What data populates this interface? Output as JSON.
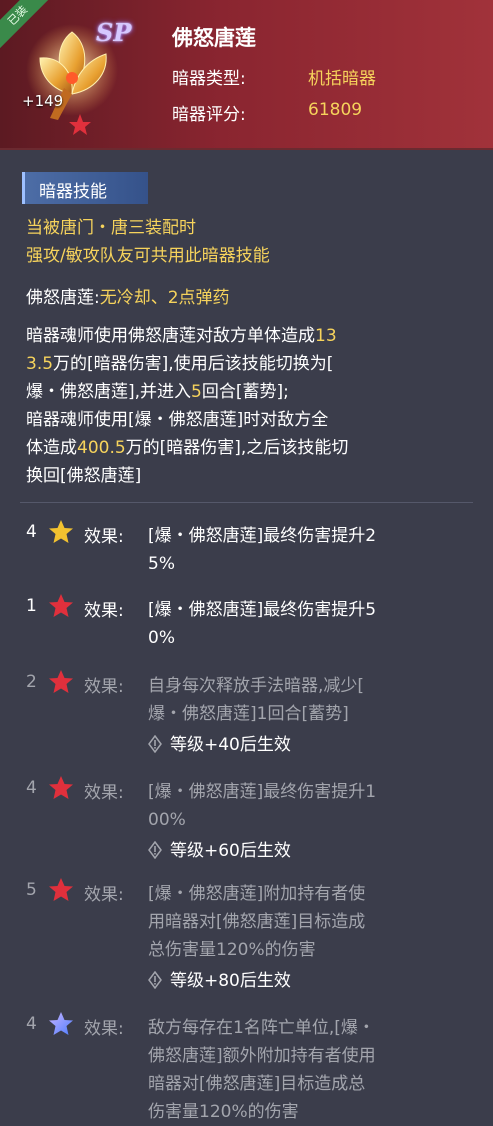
{
  "header": {
    "equipped_badge": "已装",
    "sp_badge": "SP",
    "level": "+149",
    "name": "佛怒唐莲",
    "type_label": "暗器类型:",
    "type_value": "机括暗器",
    "score_label": "暗器评分:",
    "score_value": "61809"
  },
  "skill": {
    "section_title": "暗器技能",
    "condition_lines": [
      "当被唐门・唐三装配时",
      "强攻/敏攻队友可共用此暗器技能"
    ],
    "name_label": "佛怒唐莲:",
    "name_detail": "无冷却、2点弹药",
    "desc_lines": [
      {
        "parts": [
          "暗器魂师使用佛怒唐莲对敌方单体造成",
          "13"
        ]
      },
      {
        "parts": [
          "3.5",
          "万的[暗器伤害],使用后该技能切换为["
        ]
      },
      {
        "parts": [
          "爆・佛怒唐莲],并进入",
          "5",
          "回合[蓄势];"
        ]
      },
      {
        "parts": [
          "暗器魂师使用[爆・佛怒唐莲]时对敌方全"
        ]
      },
      {
        "parts": [
          "体造成",
          "400.5",
          "万的[暗器伤害],之后该技能切"
        ]
      },
      {
        "parts": [
          "换回[佛怒唐莲]"
        ]
      }
    ]
  },
  "effects": [
    {
      "num": "4",
      "star": "gold",
      "label": "效果:",
      "lines": [
        "[爆・佛怒唐莲]最终伤害提升2",
        "5%"
      ],
      "active": true,
      "requirement": ""
    },
    {
      "num": "1",
      "star": "red",
      "label": "效果:",
      "lines": [
        "[爆・佛怒唐莲]最终伤害提升5",
        "0%"
      ],
      "active": true,
      "requirement": ""
    },
    {
      "num": "2",
      "star": "red",
      "label": "效果:",
      "lines": [
        "自身每次释放手法暗器,减少[",
        "爆・佛怒唐莲]1回合[蓄势]"
      ],
      "active": false,
      "requirement": "等级+40后生效"
    },
    {
      "num": "4",
      "star": "red",
      "label": "效果:",
      "lines": [
        "[爆・佛怒唐莲]最终伤害提升1",
        "00%"
      ],
      "active": false,
      "requirement": "等级+60后生效"
    },
    {
      "num": "5",
      "star": "red",
      "label": "效果:",
      "lines": [
        "[爆・佛怒唐莲]附加持有者使",
        "用暗器对[佛怒唐莲]目标造成",
        "总伤害量120%的伤害"
      ],
      "active": false,
      "requirement": "等级+80后生效"
    },
    {
      "num": "4",
      "star": "blue",
      "label": "效果:",
      "lines": [
        "敌方每存在1名阵亡单位,[爆・",
        "佛怒唐莲]额外附加持有者使用",
        "暗器对[佛怒唐莲]目标造成总",
        "伤害量120%的伤害"
      ],
      "active": false,
      "requirement": ""
    }
  ],
  "colors": {
    "accent_yellow": "#f6d35c",
    "inactive_grey": "#a3a5ad",
    "star_gold": "#f2c230",
    "star_red": "#e0303c",
    "star_blue": "#6d8cff"
  }
}
